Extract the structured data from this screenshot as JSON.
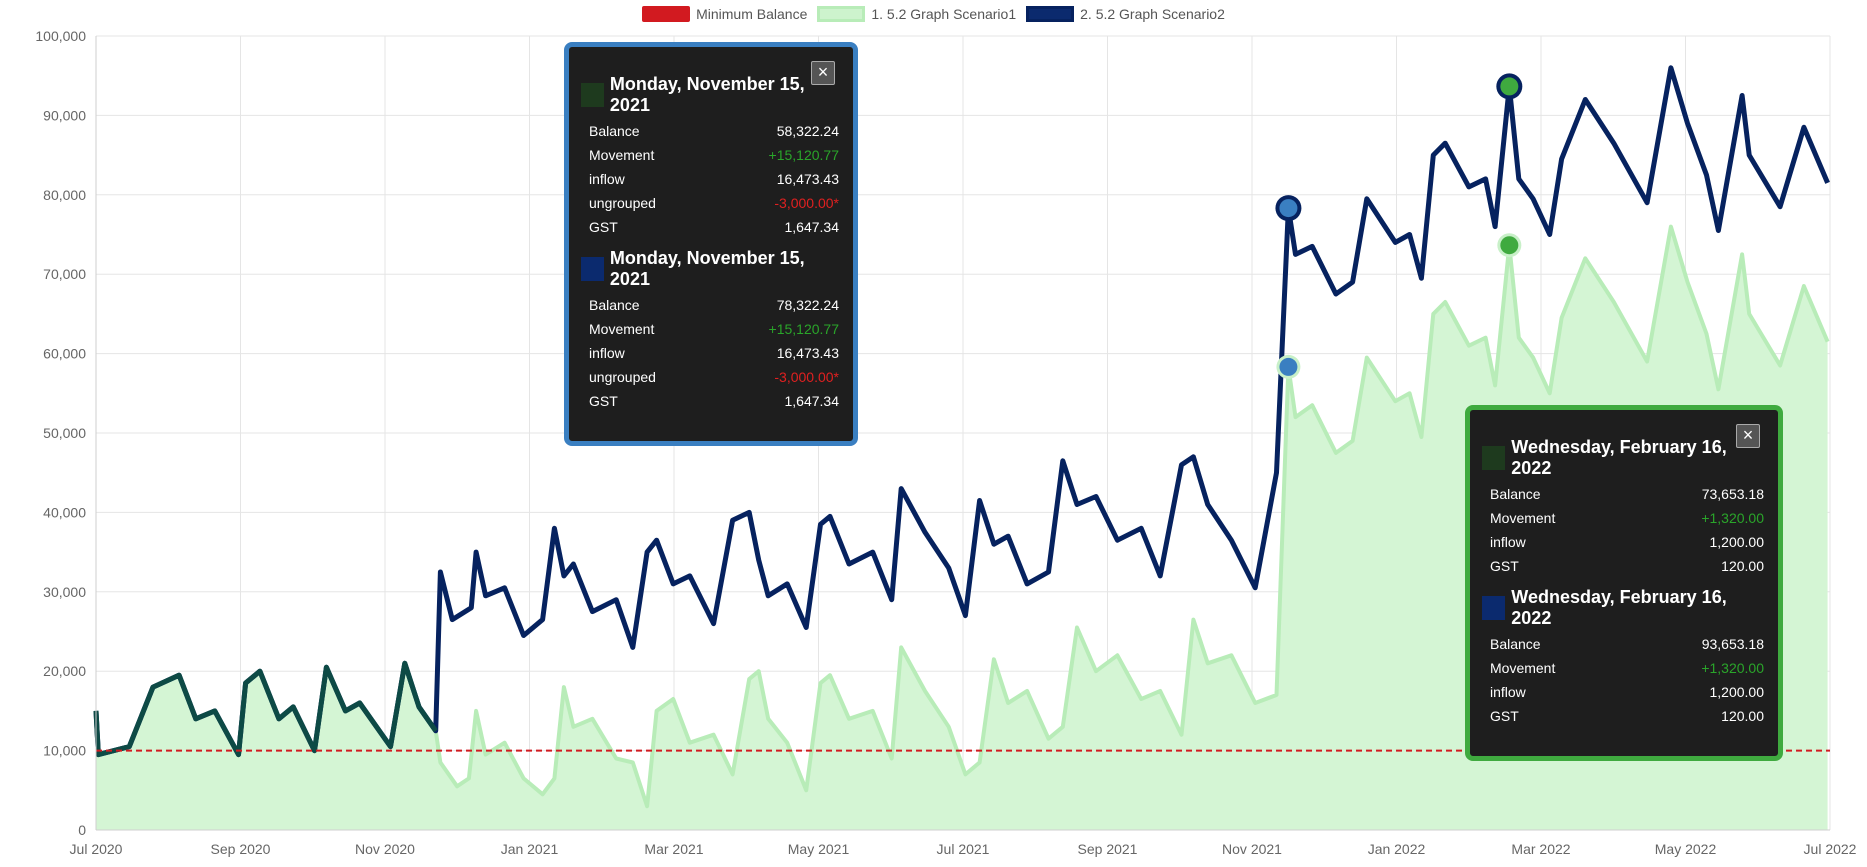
{
  "legend": [
    {
      "label": "Minimum Balance",
      "color": "#d21a20",
      "style": "dashed"
    },
    {
      "label": "1. 5.2 Graph Scenario1",
      "color": "#b8ecb8",
      "style": "fill"
    },
    {
      "label": "2. 5.2 Graph Scenario2",
      "color": "#06225f",
      "style": "line"
    }
  ],
  "chart_data": {
    "type": "line",
    "y_ticks": [
      "0",
      "10,000",
      "20,000",
      "30,000",
      "40,000",
      "50,000",
      "60,000",
      "70,000",
      "80,000",
      "90,000",
      "100,000"
    ],
    "ylim": [
      0,
      100000
    ],
    "x_ticks": [
      "Jul 2020",
      "Sep 2020",
      "Nov 2020",
      "Jan 2021",
      "Mar 2021",
      "May 2021",
      "Jul 2021",
      "Sep 2021",
      "Nov 2021",
      "Jan 2022",
      "Mar 2022",
      "May 2022",
      "Jul 2022"
    ],
    "xlim": [
      "2020-07-01",
      "2022-07-01"
    ],
    "grid": true,
    "minimum_balance": 10000,
    "series": [
      {
        "name": "1. 5.2 Graph Scenario1",
        "color": "#b8ecb8",
        "fill": "#d4f5d4",
        "points": [
          [
            "2020-07-01",
            15000
          ],
          [
            "2020-07-02",
            9500
          ],
          [
            "2020-07-15",
            10500
          ],
          [
            "2020-07-25",
            18000
          ],
          [
            "2020-08-05",
            19500
          ],
          [
            "2020-08-12",
            14000
          ],
          [
            "2020-08-20",
            15000
          ],
          [
            "2020-08-30",
            9500
          ],
          [
            "2020-09-02",
            18500
          ],
          [
            "2020-09-08",
            20000
          ],
          [
            "2020-09-16",
            14000
          ],
          [
            "2020-09-22",
            15500
          ],
          [
            "2020-10-01",
            10000
          ],
          [
            "2020-10-06",
            20500
          ],
          [
            "2020-10-14",
            15000
          ],
          [
            "2020-10-20",
            16000
          ],
          [
            "2020-11-02",
            10500
          ],
          [
            "2020-11-08",
            21000
          ],
          [
            "2020-11-14",
            15500
          ],
          [
            "2020-11-21",
            12500
          ],
          [
            "2020-11-23",
            8500
          ],
          [
            "2020-11-30",
            5500
          ],
          [
            "2020-12-05",
            6500
          ],
          [
            "2020-12-08",
            15000
          ],
          [
            "2020-12-12",
            9500
          ],
          [
            "2020-12-20",
            11000
          ],
          [
            "2020-12-28",
            6500
          ],
          [
            "2021-01-05",
            4500
          ],
          [
            "2021-01-10",
            6500
          ],
          [
            "2021-01-14",
            18000
          ],
          [
            "2021-01-18",
            13000
          ],
          [
            "2021-01-26",
            14000
          ],
          [
            "2021-02-05",
            9000
          ],
          [
            "2021-02-12",
            8500
          ],
          [
            "2021-02-18",
            3000
          ],
          [
            "2021-02-22",
            15000
          ],
          [
            "2021-03-01",
            16500
          ],
          [
            "2021-03-08",
            11000
          ],
          [
            "2021-03-18",
            12000
          ],
          [
            "2021-03-26",
            7000
          ],
          [
            "2021-04-02",
            19000
          ],
          [
            "2021-04-06",
            20000
          ],
          [
            "2021-04-10",
            14000
          ],
          [
            "2021-04-18",
            11000
          ],
          [
            "2021-04-26",
            5000
          ],
          [
            "2021-05-02",
            18500
          ],
          [
            "2021-05-06",
            19500
          ],
          [
            "2021-05-14",
            14000
          ],
          [
            "2021-05-24",
            15000
          ],
          [
            "2021-06-01",
            9000
          ],
          [
            "2021-06-05",
            23000
          ],
          [
            "2021-06-15",
            17500
          ],
          [
            "2021-06-25",
            13000
          ],
          [
            "2021-07-02",
            7000
          ],
          [
            "2021-07-08",
            8500
          ],
          [
            "2021-07-14",
            21500
          ],
          [
            "2021-07-20",
            16000
          ],
          [
            "2021-07-28",
            17500
          ],
          [
            "2021-08-06",
            11500
          ],
          [
            "2021-08-12",
            13000
          ],
          [
            "2021-08-18",
            25500
          ],
          [
            "2021-08-26",
            20000
          ],
          [
            "2021-09-04",
            22000
          ],
          [
            "2021-09-14",
            16500
          ],
          [
            "2021-09-22",
            17500
          ],
          [
            "2021-10-01",
            12000
          ],
          [
            "2021-10-06",
            26500
          ],
          [
            "2021-10-12",
            21000
          ],
          [
            "2021-10-22",
            22000
          ],
          [
            "2021-11-01",
            16000
          ],
          [
            "2021-11-10",
            17000
          ],
          [
            "2021-11-15",
            58322
          ],
          [
            "2021-11-18",
            52000
          ],
          [
            "2021-11-25",
            53500
          ],
          [
            "2021-12-05",
            47500
          ],
          [
            "2021-12-12",
            49000
          ],
          [
            "2021-12-18",
            59500
          ],
          [
            "2021-12-30",
            54000
          ],
          [
            "2022-01-05",
            55000
          ],
          [
            "2022-01-10",
            49500
          ],
          [
            "2022-01-15",
            65000
          ],
          [
            "2022-01-20",
            66500
          ],
          [
            "2022-01-30",
            61000
          ],
          [
            "2022-02-06",
            62000
          ],
          [
            "2022-02-10",
            56000
          ],
          [
            "2022-02-16",
            73653
          ],
          [
            "2022-02-20",
            62000
          ],
          [
            "2022-02-26",
            59500
          ],
          [
            "2022-03-05",
            55000
          ],
          [
            "2022-03-10",
            64500
          ],
          [
            "2022-03-20",
            72000
          ],
          [
            "2022-04-01",
            66500
          ],
          [
            "2022-04-15",
            59000
          ],
          [
            "2022-04-25",
            76000
          ],
          [
            "2022-05-02",
            69000
          ],
          [
            "2022-05-10",
            62500
          ],
          [
            "2022-05-15",
            55500
          ],
          [
            "2022-05-25",
            72500
          ],
          [
            "2022-05-28",
            65000
          ],
          [
            "2022-06-10",
            58500
          ],
          [
            "2022-06-20",
            68500
          ],
          [
            "2022-06-30",
            61500
          ]
        ]
      },
      {
        "name": "2. 5.2 Graph Scenario2",
        "color": "#06225f",
        "points": [
          [
            "2020-07-01",
            15000
          ],
          [
            "2020-07-02",
            9500
          ],
          [
            "2020-07-15",
            10500
          ],
          [
            "2020-07-25",
            18000
          ],
          [
            "2020-08-05",
            19500
          ],
          [
            "2020-08-12",
            14000
          ],
          [
            "2020-08-20",
            15000
          ],
          [
            "2020-08-30",
            9500
          ],
          [
            "2020-09-02",
            18500
          ],
          [
            "2020-09-08",
            20000
          ],
          [
            "2020-09-16",
            14000
          ],
          [
            "2020-09-22",
            15500
          ],
          [
            "2020-10-01",
            10000
          ],
          [
            "2020-10-06",
            20500
          ],
          [
            "2020-10-14",
            15000
          ],
          [
            "2020-10-20",
            16000
          ],
          [
            "2020-11-02",
            10500
          ],
          [
            "2020-11-08",
            21000
          ],
          [
            "2020-11-14",
            15500
          ],
          [
            "2020-11-21",
            12500
          ],
          [
            "2020-11-23",
            32500
          ],
          [
            "2020-11-28",
            26500
          ],
          [
            "2020-12-06",
            28000
          ],
          [
            "2020-12-08",
            35000
          ],
          [
            "2020-12-12",
            29500
          ],
          [
            "2020-12-20",
            30500
          ],
          [
            "2020-12-28",
            24500
          ],
          [
            "2021-01-05",
            26500
          ],
          [
            "2021-01-10",
            38000
          ],
          [
            "2021-01-14",
            32000
          ],
          [
            "2021-01-18",
            33500
          ],
          [
            "2021-01-26",
            27500
          ],
          [
            "2021-02-05",
            29000
          ],
          [
            "2021-02-12",
            23000
          ],
          [
            "2021-02-18",
            35000
          ],
          [
            "2021-02-22",
            36500
          ],
          [
            "2021-03-01",
            31000
          ],
          [
            "2021-03-08",
            32000
          ],
          [
            "2021-03-18",
            26000
          ],
          [
            "2021-03-26",
            39000
          ],
          [
            "2021-04-02",
            40000
          ],
          [
            "2021-04-06",
            34000
          ],
          [
            "2021-04-10",
            29500
          ],
          [
            "2021-04-18",
            31000
          ],
          [
            "2021-04-26",
            25500
          ],
          [
            "2021-05-02",
            38500
          ],
          [
            "2021-05-06",
            39500
          ],
          [
            "2021-05-14",
            33500
          ],
          [
            "2021-05-24",
            35000
          ],
          [
            "2021-06-01",
            29000
          ],
          [
            "2021-06-05",
            43000
          ],
          [
            "2021-06-15",
            37500
          ],
          [
            "2021-06-25",
            33000
          ],
          [
            "2021-07-02",
            27000
          ],
          [
            "2021-07-08",
            41500
          ],
          [
            "2021-07-14",
            36000
          ],
          [
            "2021-07-20",
            37000
          ],
          [
            "2021-07-28",
            31000
          ],
          [
            "2021-08-06",
            32500
          ],
          [
            "2021-08-12",
            46500
          ],
          [
            "2021-08-18",
            41000
          ],
          [
            "2021-08-26",
            42000
          ],
          [
            "2021-09-04",
            36500
          ],
          [
            "2021-09-14",
            38000
          ],
          [
            "2021-09-22",
            32000
          ],
          [
            "2021-10-01",
            46000
          ],
          [
            "2021-10-06",
            47000
          ],
          [
            "2021-10-12",
            41000
          ],
          [
            "2021-10-22",
            36500
          ],
          [
            "2021-11-01",
            30500
          ],
          [
            "2021-11-10",
            45000
          ],
          [
            "2021-11-15",
            78322
          ],
          [
            "2021-11-18",
            72500
          ],
          [
            "2021-11-25",
            73500
          ],
          [
            "2021-12-05",
            67500
          ],
          [
            "2021-12-12",
            69000
          ],
          [
            "2021-12-18",
            79500
          ],
          [
            "2021-12-30",
            74000
          ],
          [
            "2022-01-05",
            75000
          ],
          [
            "2022-01-10",
            69500
          ],
          [
            "2022-01-15",
            85000
          ],
          [
            "2022-01-20",
            86500
          ],
          [
            "2022-01-30",
            81000
          ],
          [
            "2022-02-06",
            82000
          ],
          [
            "2022-02-10",
            76000
          ],
          [
            "2022-02-16",
            93653
          ],
          [
            "2022-02-20",
            82000
          ],
          [
            "2022-02-26",
            79500
          ],
          [
            "2022-03-05",
            75000
          ],
          [
            "2022-03-10",
            84500
          ],
          [
            "2022-03-20",
            92000
          ],
          [
            "2022-04-01",
            86500
          ],
          [
            "2022-04-15",
            79000
          ],
          [
            "2022-04-25",
            96000
          ],
          [
            "2022-05-02",
            89000
          ],
          [
            "2022-05-10",
            82500
          ],
          [
            "2022-05-15",
            75500
          ],
          [
            "2022-05-25",
            92500
          ],
          [
            "2022-05-28",
            85000
          ],
          [
            "2022-06-10",
            78500
          ],
          [
            "2022-06-20",
            88500
          ],
          [
            "2022-06-30",
            81500
          ]
        ]
      }
    ],
    "highlighted_points": [
      {
        "date": "2021-11-15",
        "value": 58322.24,
        "series": "1. 5.2 Graph Scenario1",
        "color": "#3a7fc1"
      },
      {
        "date": "2021-11-15",
        "value": 78322.24,
        "series": "2. 5.2 Graph Scenario2",
        "color": "#3a7fc1"
      },
      {
        "date": "2022-02-16",
        "value": 73653.18,
        "series": "1. 5.2 Graph Scenario1",
        "color": "#3faa3f"
      },
      {
        "date": "2022-02-16",
        "value": 93653.18,
        "series": "2. 5.2 Graph Scenario2",
        "color": "#3faa3f"
      }
    ]
  },
  "tooltips": [
    {
      "close": "×",
      "sections": [
        {
          "title": "Monday, November 15, 2021",
          "swatch": "#1e3a1e",
          "rows": [
            [
              "Balance",
              "58,322.24",
              ""
            ],
            [
              "Movement",
              "+15,120.77",
              "pos"
            ],
            [
              "inflow",
              "16,473.43",
              ""
            ],
            [
              "ungrouped",
              "-3,000.00*",
              "neg"
            ],
            [
              "GST",
              "1,647.34",
              ""
            ]
          ]
        },
        {
          "title": "Monday, November 15, 2021",
          "swatch": "#0b2a6e",
          "rows": [
            [
              "Balance",
              "78,322.24",
              ""
            ],
            [
              "Movement",
              "+15,120.77",
              "pos"
            ],
            [
              "inflow",
              "16,473.43",
              ""
            ],
            [
              "ungrouped",
              "-3,000.00*",
              "neg"
            ],
            [
              "GST",
              "1,647.34",
              ""
            ]
          ]
        }
      ]
    },
    {
      "close": "×",
      "sections": [
        {
          "title": "Wednesday, February 16, 2022",
          "swatch": "#1e3a1e",
          "rows": [
            [
              "Balance",
              "73,653.18",
              ""
            ],
            [
              "Movement",
              "+1,320.00",
              "pos"
            ],
            [
              "inflow",
              "1,200.00",
              ""
            ],
            [
              "GST",
              "120.00",
              ""
            ]
          ]
        },
        {
          "title": "Wednesday, February 16, 2022",
          "swatch": "#0b2a6e",
          "rows": [
            [
              "Balance",
              "93,653.18",
              ""
            ],
            [
              "Movement",
              "+1,320.00",
              "pos"
            ],
            [
              "inflow",
              "1,200.00",
              ""
            ],
            [
              "GST",
              "120.00",
              ""
            ]
          ]
        }
      ]
    }
  ]
}
